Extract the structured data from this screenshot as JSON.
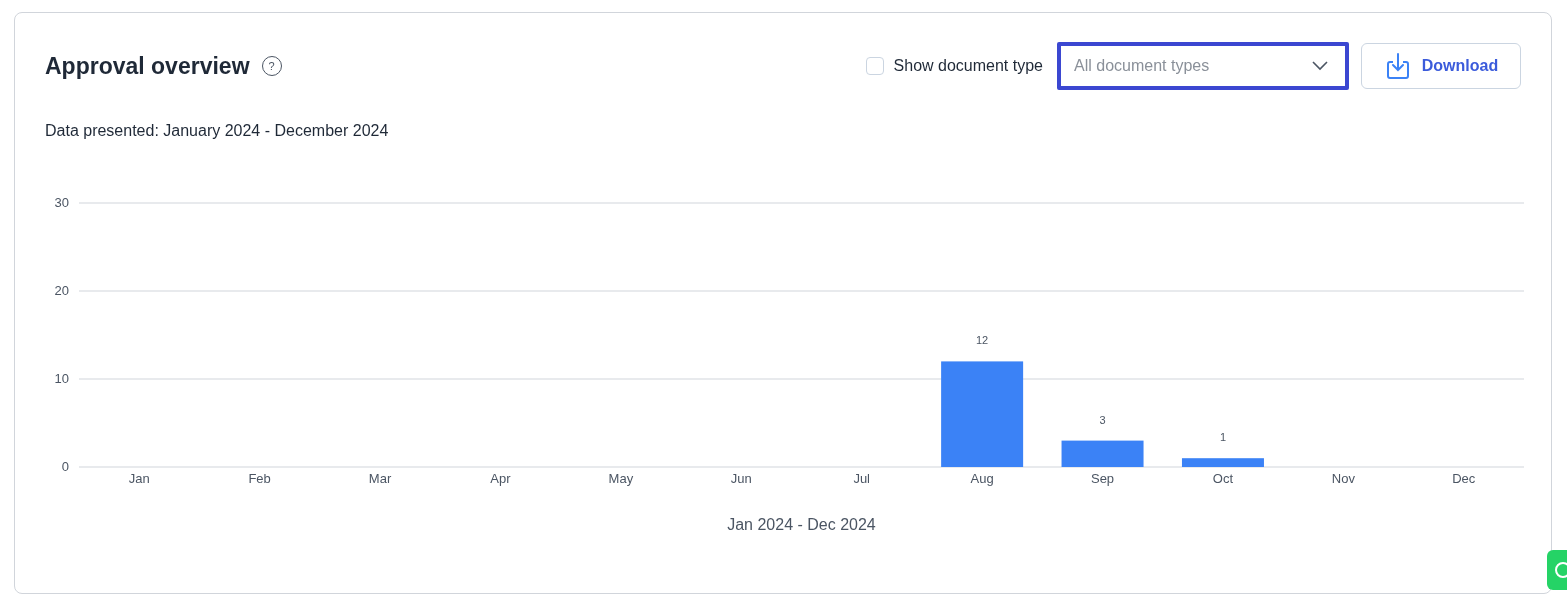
{
  "card": {
    "title": "Approval overview",
    "help_icon": "?",
    "show_document_type": {
      "label": "Show document type",
      "checked": false
    },
    "document_type_select": {
      "placeholder": "All document types",
      "focused": true
    },
    "download_button": "Download",
    "period_text": "Data presented: January 2024 - December 2024",
    "chart_data": {
      "type": "bar",
      "xlabel": "Jan 2024 - Dec 2024",
      "categories": [
        "Jan",
        "Feb",
        "Mar",
        "Apr",
        "May",
        "Jun",
        "Jul",
        "Aug",
        "Sep",
        "Oct",
        "Nov",
        "Dec"
      ],
      "series": [
        {
          "color": "#3b82f6",
          "values": [
            0,
            0,
            0,
            0,
            0,
            0,
            0,
            12,
            3,
            1,
            0,
            0
          ]
        }
      ],
      "ylim": [
        0,
        30
      ],
      "yticks": [
        0,
        10,
        20,
        30
      ],
      "value_labels": [
        null,
        null,
        null,
        null,
        null,
        null,
        null,
        "12",
        "3",
        "1",
        null,
        null
      ]
    }
  }
}
